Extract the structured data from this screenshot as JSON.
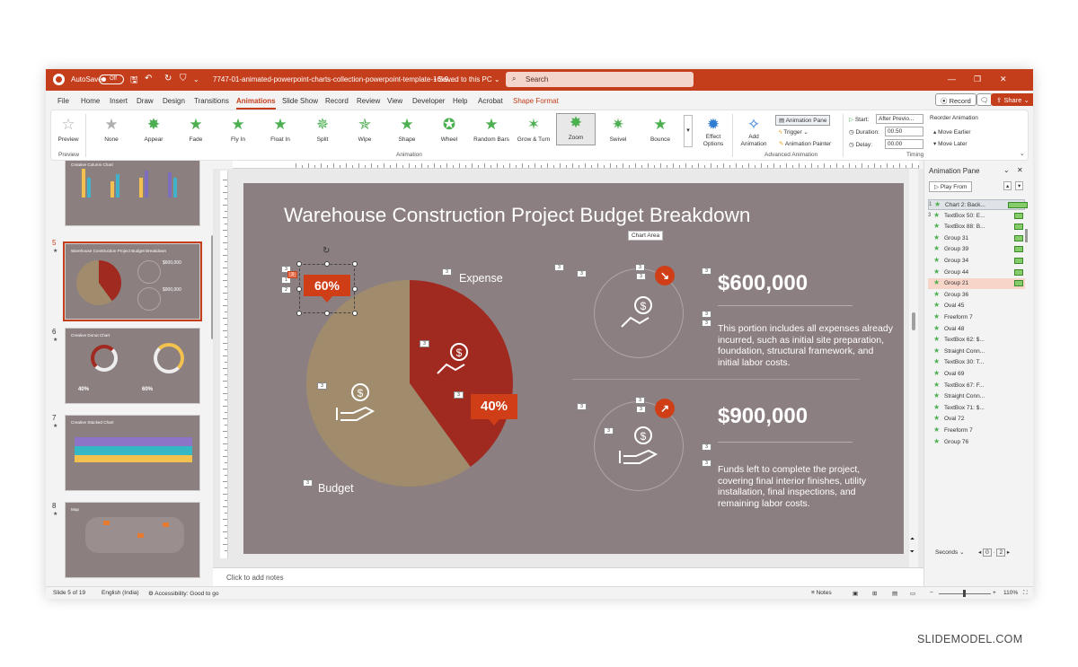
{
  "titlebar": {
    "autosave_label": "AutoSave",
    "autosave_state": "Off",
    "file_title": "7747-01-animated-powerpoint-charts-collection-powerpoint-template-16x9....",
    "save_status": "Saved to this PC",
    "search_placeholder": "Search"
  },
  "menu": [
    "File",
    "Home",
    "Insert",
    "Draw",
    "Design",
    "Transitions",
    "Animations",
    "Slide Show",
    "Record",
    "Review",
    "View",
    "Developer",
    "Help",
    "Acrobat",
    "Shape Format"
  ],
  "menu_active": "Animations",
  "menu_buttons": {
    "record": "Record",
    "share": "Share"
  },
  "ribbon": {
    "preview": "Preview",
    "preview_group": "Preview",
    "animations": [
      "None",
      "Appear",
      "Fade",
      "Fly In",
      "Float In",
      "Split",
      "Wipe",
      "Shape",
      "Wheel",
      "Random Bars",
      "Grow & Turn",
      "Zoom",
      "Swivel",
      "Bounce"
    ],
    "selected_animation": "Zoom",
    "animation_group": "Animation",
    "effect_options": "Effect Options",
    "add_animation": "Add Animation",
    "animation_pane": "Animation Pane",
    "trigger": "Trigger",
    "animation_painter": "Animation Painter",
    "advanced_group": "Advanced Animation",
    "start_label": "Start:",
    "start_value": "After Previo...",
    "duration_label": "Duration:",
    "duration_value": "00.50",
    "delay_label": "Delay:",
    "delay_value": "00.00",
    "reorder": "Reorder Animation",
    "move_earlier": "Move Earlier",
    "move_later": "Move Later",
    "timing_group": "Timing"
  },
  "thumbnails": [
    {
      "num": "",
      "title": "Creative Column Chart",
      "selected": false
    },
    {
      "num": "5",
      "title": "Warehouse Construction Project Budget Breakdown",
      "selected": true
    },
    {
      "num": "6",
      "title": "Creative Donut Chart",
      "selected": false
    },
    {
      "num": "7",
      "title": "Creative Stacked Chart",
      "selected": false
    },
    {
      "num": "8",
      "title": "Map",
      "selected": false
    }
  ],
  "slide": {
    "title": "Warehouse Construction Project Budget Breakdown",
    "tooltip": "Chart Area",
    "expense_label": "Expense",
    "budget_label": "Budget",
    "callout_budget": "60%",
    "callout_expense": "40%",
    "amount_1": "$600,000",
    "desc_1": "This portion includes all expenses already incurred, such as initial site preparation, foundation, structural framework, and initial labor costs.",
    "amount_2": "$900,000",
    "desc_2": "Funds left to complete the project, covering final interior finishes, utility installation, final inspections, and remaining labor costs.",
    "marker_num": "3",
    "marker_nums": [
      "1",
      "2"
    ]
  },
  "animation_pane": {
    "title": "Animation Pane",
    "play_from": "Play From",
    "items": [
      {
        "n": "1",
        "label": "Chart 2: Back...",
        "type": "first"
      },
      {
        "n": "3",
        "label": "TextBox 50: E...",
        "type": "normal"
      },
      {
        "n": "",
        "label": "TextBox 88: B...",
        "type": "normal"
      },
      {
        "n": "",
        "label": "Group 31",
        "type": "normal"
      },
      {
        "n": "",
        "label": "Group 39",
        "type": "normal"
      },
      {
        "n": "",
        "label": "Group 34",
        "type": "normal"
      },
      {
        "n": "",
        "label": "Group 44",
        "type": "normal"
      },
      {
        "n": "",
        "label": "Group 21",
        "type": "selected"
      },
      {
        "n": "",
        "label": "Group 36",
        "type": "normal"
      },
      {
        "n": "",
        "label": "Oval 45",
        "type": "normal"
      },
      {
        "n": "",
        "label": "Freeform 7",
        "type": "normal"
      },
      {
        "n": "",
        "label": "Oval 48",
        "type": "normal"
      },
      {
        "n": "",
        "label": "TextBox 62: $...",
        "type": "normal"
      },
      {
        "n": "",
        "label": "Straight Conn...",
        "type": "normal"
      },
      {
        "n": "",
        "label": "TextBox 30: T...",
        "type": "normal"
      },
      {
        "n": "",
        "label": "Oval 69",
        "type": "normal"
      },
      {
        "n": "",
        "label": "TextBox 67: F...",
        "type": "normal"
      },
      {
        "n": "",
        "label": "Straight Conn...",
        "type": "normal"
      },
      {
        "n": "",
        "label": "TextBox 71: $...",
        "type": "normal"
      },
      {
        "n": "",
        "label": "Oval 72",
        "type": "normal"
      },
      {
        "n": "",
        "label": "Freeform 7",
        "type": "normal"
      },
      {
        "n": "",
        "label": "Group 76",
        "type": "normal"
      }
    ],
    "seconds_label": "Seconds",
    "timeline_start": "0",
    "timeline_end": "2"
  },
  "notes_placeholder": "Click to add notes",
  "status": {
    "slide_info": "Slide 5 of 19",
    "language": "English (India)",
    "accessibility": "Accessibility: Good to go",
    "notes": "Notes",
    "zoom": "110%"
  },
  "watermark": "SLIDEMODEL.COM",
  "chart_data": {
    "type": "pie",
    "categories": [
      "Budget",
      "Expense"
    ],
    "values": [
      60,
      40
    ],
    "colors": [
      "#a08c6c",
      "#a02a1f"
    ],
    "title": "",
    "data_labels": [
      "60%",
      "40%"
    ]
  },
  "colors": {
    "accent": "#c43e1c",
    "slide_bg": "#8c7f81",
    "callout": "#cf3e17"
  }
}
